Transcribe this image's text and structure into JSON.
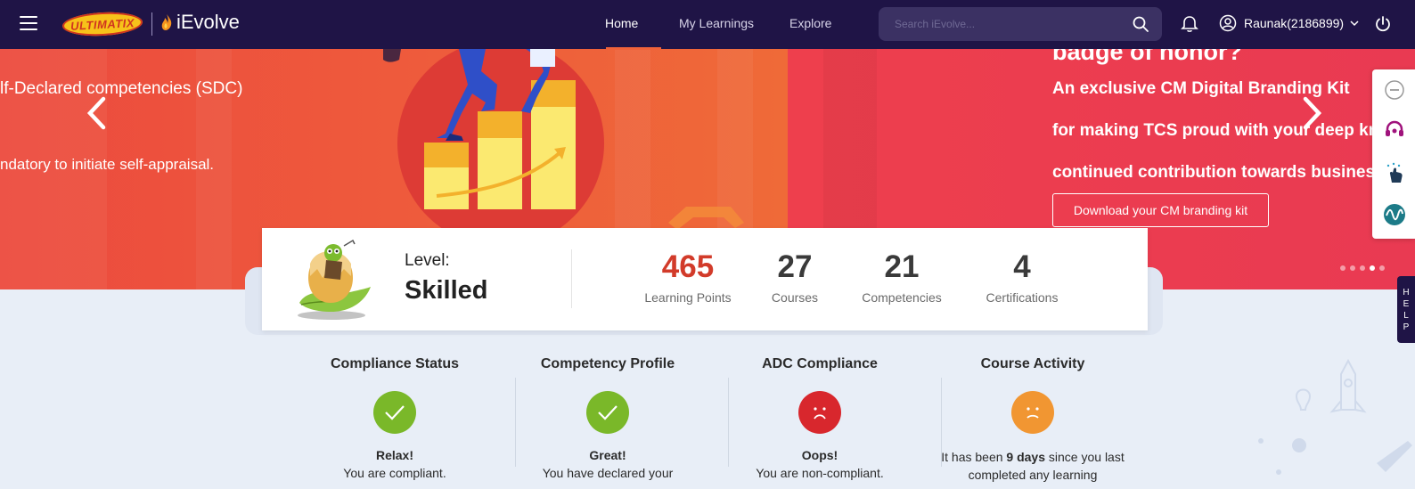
{
  "header": {
    "logo_ultimatix": "ULTIMATIX",
    "logo_app": "iEvolve",
    "nav": [
      {
        "label": "Home",
        "active": true
      },
      {
        "label": "My Learnings",
        "active": false
      },
      {
        "label": "Explore",
        "active": false
      }
    ],
    "search_placeholder": "Search iEvolve...",
    "user_name": "Raunak(2186899)"
  },
  "banner": {
    "left_line1": "lf-Declared competencies (SDC)",
    "left_line2": "ndatory to initiate self-appraisal.",
    "right_heading": "badge of honor?",
    "right_line1": "An exclusive CM Digital Branding Kit",
    "right_line2": "for making TCS proud with your deep kn",
    "right_line3": "continued contribution towards business",
    "download_button": "Download your CM branding kit",
    "slide_count": 5,
    "active_slide": 4
  },
  "stats": {
    "level_label": "Level:",
    "level_value": "Skilled",
    "items": [
      {
        "value": "465",
        "label": "Learning Points"
      },
      {
        "value": "27",
        "label": "Courses"
      },
      {
        "value": "21",
        "label": "Competencies"
      },
      {
        "value": "4",
        "label": "Certifications"
      }
    ]
  },
  "help_label": [
    "H",
    "E",
    "L",
    "P"
  ],
  "sections": [
    {
      "title": "Compliance Status",
      "status": "good",
      "headline": "Relax!",
      "sub": "You are compliant."
    },
    {
      "title": "Competency Profile",
      "status": "good",
      "headline": "Great!",
      "sub": "You have declared your"
    },
    {
      "title": "ADC Compliance",
      "status": "bad",
      "headline": "Oops!",
      "sub": "You are non-compliant."
    },
    {
      "title": "Course Activity",
      "status": "warn",
      "sub_before": "It has been ",
      "sub_bold": "9 days",
      "sub_after": " since you last completed any learning"
    }
  ],
  "colors": {
    "nav_bg": "#1f1446",
    "accent": "#f0623a",
    "good": "#7ab829",
    "bad": "#d8272d",
    "warn": "#f19632",
    "points": "#d23b2a"
  }
}
